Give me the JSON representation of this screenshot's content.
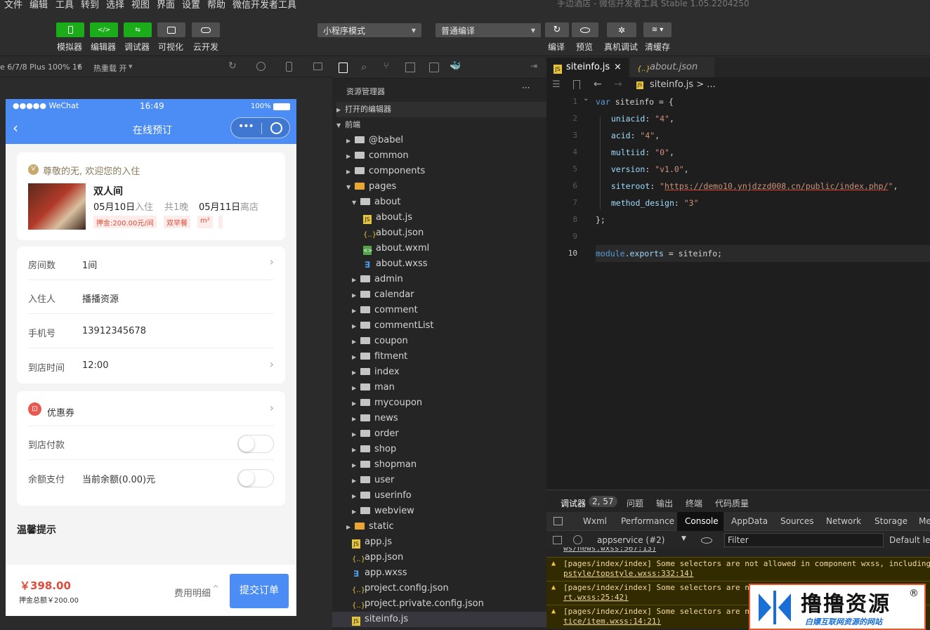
{
  "menubar": {
    "items": [
      "文件",
      "编辑",
      "工具",
      "转到",
      "选择",
      "视图",
      "界面",
      "设置",
      "帮助",
      "微信开发者工具"
    ],
    "window_title": "手边酒店 - 微信开发者工具 Stable 1.05.2204250"
  },
  "toolbar": {
    "left_buttons": [
      "模拟器",
      "编辑器",
      "调试器",
      "可视化",
      "云开发"
    ],
    "mode_select": "小程序模式",
    "compile_select": "普通编译",
    "right_buttons": [
      "编译",
      "预览",
      "真机调试",
      "清缓存"
    ]
  },
  "simbar": {
    "device": "e 6/7/8 Plus 100% 16",
    "hotreload": "热重载 开"
  },
  "phone": {
    "status": {
      "carrier": "●●●●● WeChat",
      "time": "16:49",
      "battery": "100%"
    },
    "nav": {
      "title": "在线预订",
      "more": "•••"
    },
    "welcome": "尊敬的无, 欢迎您的入住",
    "room": {
      "name": "双人间",
      "checkin_date": "05月10日",
      "checkin_label": "入住",
      "nights": "共1晚",
      "checkout_date": "05月11日",
      "checkout_label": "离店",
      "tags": [
        "押金:200.00元/间",
        "双早餐",
        "m²"
      ]
    },
    "form": [
      {
        "label": "房间数",
        "value": "1间",
        "chev": true
      },
      {
        "label": "入住人",
        "value": "播播资源",
        "chev": false
      },
      {
        "label": "手机号",
        "value": "13912345678",
        "chev": false
      },
      {
        "label": "到店时间",
        "value": "12:00",
        "chev": true
      }
    ],
    "coupon": "优惠券",
    "pay": [
      {
        "label": "到店付款",
        "value": ""
      },
      {
        "label": "余额支付",
        "value": "当前余额(0.00)元"
      }
    ],
    "tips": "温馨提示",
    "footer": {
      "price": "￥398.00",
      "deposit": "押金总额￥200.00",
      "detail": "费用明细",
      "submit": "提交订单"
    }
  },
  "explorer": {
    "title": "资源管理器",
    "more": "···",
    "open_editors": "打开的编辑器",
    "root": "前端",
    "items": [
      {
        "name": "@babel",
        "type": "folder",
        "indent": 1,
        "arrow": "▶"
      },
      {
        "name": "common",
        "type": "folder",
        "indent": 1,
        "arrow": "▶"
      },
      {
        "name": "components",
        "type": "folder-g",
        "indent": 1,
        "arrow": "▶"
      },
      {
        "name": "pages",
        "type": "folder-y",
        "indent": 1,
        "arrow": "▼"
      },
      {
        "name": "about",
        "type": "folder",
        "indent": 2,
        "arrow": "▼"
      },
      {
        "name": "about.js",
        "type": "js",
        "indent": 3,
        "arrow": ""
      },
      {
        "name": "about.json",
        "type": "json",
        "indent": 3,
        "arrow": ""
      },
      {
        "name": "about.wxml",
        "type": "wxml",
        "indent": 3,
        "arrow": ""
      },
      {
        "name": "about.wxss",
        "type": "wxss",
        "indent": 3,
        "arrow": ""
      },
      {
        "name": "admin",
        "type": "folder",
        "indent": 2,
        "arrow": "▶"
      },
      {
        "name": "calendar",
        "type": "folder",
        "indent": 2,
        "arrow": "▶"
      },
      {
        "name": "comment",
        "type": "folder",
        "indent": 2,
        "arrow": "▶"
      },
      {
        "name": "commentList",
        "type": "folder",
        "indent": 2,
        "arrow": "▶"
      },
      {
        "name": "coupon",
        "type": "folder",
        "indent": 2,
        "arrow": "▶"
      },
      {
        "name": "fitment",
        "type": "folder",
        "indent": 2,
        "arrow": "▶"
      },
      {
        "name": "index",
        "type": "folder",
        "indent": 2,
        "arrow": "▶"
      },
      {
        "name": "man",
        "type": "folder",
        "indent": 2,
        "arrow": "▶"
      },
      {
        "name": "mycoupon",
        "type": "folder",
        "indent": 2,
        "arrow": "▶"
      },
      {
        "name": "news",
        "type": "folder",
        "indent": 2,
        "arrow": "▶"
      },
      {
        "name": "order",
        "type": "folder",
        "indent": 2,
        "arrow": "▶"
      },
      {
        "name": "shop",
        "type": "folder",
        "indent": 2,
        "arrow": "▶"
      },
      {
        "name": "shopman",
        "type": "folder",
        "indent": 2,
        "arrow": "▶"
      },
      {
        "name": "user",
        "type": "folder",
        "indent": 2,
        "arrow": "▶"
      },
      {
        "name": "userinfo",
        "type": "folder",
        "indent": 2,
        "arrow": "▶"
      },
      {
        "name": "webview",
        "type": "folder",
        "indent": 2,
        "arrow": "▶"
      },
      {
        "name": "static",
        "type": "folder-y",
        "indent": 1,
        "arrow": "▶"
      },
      {
        "name": "app.js",
        "type": "js",
        "indent": 1,
        "arrow": ""
      },
      {
        "name": "app.json",
        "type": "json",
        "indent": 1,
        "arrow": ""
      },
      {
        "name": "app.wxss",
        "type": "wxss",
        "indent": 1,
        "arrow": ""
      },
      {
        "name": "project.config.json",
        "type": "json",
        "indent": 1,
        "arrow": ""
      },
      {
        "name": "project.private.config.json",
        "type": "json",
        "indent": 1,
        "arrow": ""
      },
      {
        "name": "siteinfo.js",
        "type": "js",
        "indent": 1,
        "arrow": ""
      }
    ]
  },
  "editor": {
    "tabs": [
      {
        "name": "siteinfo.js",
        "close": "×"
      },
      {
        "name": "about.json"
      }
    ],
    "breadcrumb": "siteinfo.js > ...",
    "lines": [
      {
        "n": "1",
        "html": "<span class='kw'>var</span> siteinfo = {"
      },
      {
        "n": "2",
        "html": "  <span class='vv'>uniacid</span>: <span class='str'>\"4\"</span>,"
      },
      {
        "n": "3",
        "html": "  <span class='vv'>acid</span>: <span class='str'>\"4\"</span>,"
      },
      {
        "n": "4",
        "html": "  <span class='vv'>multiid</span>: <span class='str'>\"0\"</span>,"
      },
      {
        "n": "5",
        "html": "  <span class='vv'>version</span>: <span class='str'>\"v1.0\"</span>,"
      },
      {
        "n": "6",
        "html": "  <span class='vv'>siteroot</span>: <span class='str'>\"</span><span class='url'>https://demo10.ynjdzzd008.cn/public/index.php/</span><span class='str'>\"</span>,"
      },
      {
        "n": "7",
        "html": "  <span class='vv'>method_design</span>: <span class='str'>\"3\"</span>"
      },
      {
        "n": "8",
        "html": "};"
      },
      {
        "n": "9",
        "html": ""
      },
      {
        "n": "10",
        "html": "<span class='kw'>module</span>.<span class='vv'>exports</span> = siteinfo;"
      }
    ]
  },
  "debug": {
    "top_tabs": [
      "调试器",
      "2, 57",
      "问题",
      "输出",
      "终端",
      "代码质量"
    ],
    "tabs": [
      "Wxml",
      "Performance",
      "Console",
      "AppData",
      "Sources",
      "Network",
      "Storage",
      "Me"
    ],
    "context": "appservice (#2)",
    "filter_placeholder": "Filter",
    "levels": "Default lev",
    "clipped": "ws/news.wxss:567:13)",
    "warnings": [
      {
        "l1": "[pages/index/index] Some selectors are not allowed in component wxss, including",
        "l2": "pstyle/topstyle.wxss:332:14)"
      },
      {
        "l1": "[pages/index/index] Some selectors are n",
        "l2": "rt.wxss:25:42)"
      },
      {
        "l1": "[pages/index/index] Some selectors are n",
        "l2": "tice/item.wxss:14:21)"
      }
    ]
  },
  "watermark": {
    "title": "撸撸资源",
    "reg": "®",
    "subtitle": "白嫖互联网资源的网站"
  }
}
